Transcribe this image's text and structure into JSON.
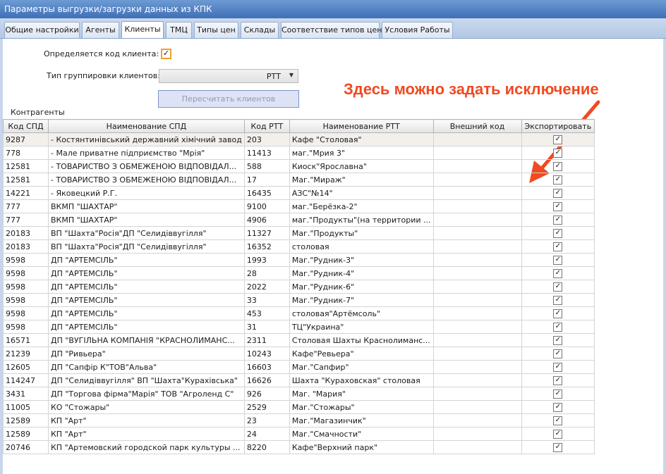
{
  "window": {
    "title": "Параметры выгрузки/загрузки данных из КПК"
  },
  "tabs": [
    {
      "label": "Общие настройки"
    },
    {
      "label": "Агенты"
    },
    {
      "label": "Клиенты"
    },
    {
      "label": "ТМЦ"
    },
    {
      "label": "Типы цен"
    },
    {
      "label": "Склады"
    },
    {
      "label": "Соответствие типов цен"
    },
    {
      "label": "Условия Работы"
    }
  ],
  "form": {
    "client_code_label": "Определяется код клиента:",
    "client_code_checked": true,
    "grouping_label": "Тип группировки клиентов:",
    "grouping_value": "РТТ",
    "recalc_button": "Пересчитать клиентов",
    "group_caption": "Контрагенты"
  },
  "annotation": {
    "text": "Здесь можно задать исключение",
    "color": "#f04a22"
  },
  "table": {
    "columns": [
      "Код СПД",
      "Наименование СПД",
      "Код РТТ",
      "Наименование РТТ",
      "Внешний код",
      "Экспортировать"
    ],
    "rows": [
      {
        "spd_code": "9287",
        "spd_name": "- Костянтинівський державний хімічний завод",
        "rtt_code": "203",
        "rtt_name": "Кафе \"Столовая\"",
        "ext": "",
        "export": true
      },
      {
        "spd_code": "778",
        "spd_name": "- Мале приватне підприємство \"Мрія\"",
        "rtt_code": "11413",
        "rtt_name": "маг.\"Мрия 3\"",
        "ext": "",
        "export": true
      },
      {
        "spd_code": "12581",
        "spd_name": "- ТОВАРИСТВО З ОБМЕЖЕНОЮ ВІДПОВІДАЛ...",
        "rtt_code": "588",
        "rtt_name": "Киоск\"Ярославна\"",
        "ext": "",
        "export": true
      },
      {
        "spd_code": "12581",
        "spd_name": "- ТОВАРИСТВО З ОБМЕЖЕНОЮ ВІДПОВІДАЛ...",
        "rtt_code": "17",
        "rtt_name": "Маг.\"Мираж\"",
        "ext": "",
        "export": true
      },
      {
        "spd_code": "14221",
        "spd_name": "- Яковецкий Р.Г.",
        "rtt_code": "16435",
        "rtt_name": "АЗС\"№14\"",
        "ext": "",
        "export": true
      },
      {
        "spd_code": "777",
        "spd_name": "ВКМП \"ШАХТАР\"",
        "rtt_code": "9100",
        "rtt_name": "маг.\"Берёзка-2\"",
        "ext": "",
        "export": true
      },
      {
        "spd_code": "777",
        "spd_name": "ВКМП \"ШАХТАР\"",
        "rtt_code": "4906",
        "rtt_name": "маг.\"Продукты\"(на территории ...",
        "ext": "",
        "export": true
      },
      {
        "spd_code": "20183",
        "spd_name": "ВП \"Шахта\"Росія\"ДП \"Селидіввугілля\"",
        "rtt_code": "11327",
        "rtt_name": "Маг.\"Продукты\"",
        "ext": "",
        "export": true
      },
      {
        "spd_code": "20183",
        "spd_name": "ВП \"Шахта\"Росія\"ДП \"Селидіввугілля\"",
        "rtt_code": "16352",
        "rtt_name": "столовая",
        "ext": "",
        "export": true
      },
      {
        "spd_code": "9598",
        "spd_name": "ДП \"АРТЕМСІЛЬ\"",
        "rtt_code": "1993",
        "rtt_name": "Маг.\"Рудник-3\"",
        "ext": "",
        "export": true
      },
      {
        "spd_code": "9598",
        "spd_name": "ДП \"АРТЕМСІЛЬ\"",
        "rtt_code": "28",
        "rtt_name": "Маг.\"Рудник-4\"",
        "ext": "",
        "export": true
      },
      {
        "spd_code": "9598",
        "spd_name": "ДП \"АРТЕМСІЛЬ\"",
        "rtt_code": "2022",
        "rtt_name": "Маг.\"Рудник-6\"",
        "ext": "",
        "export": true
      },
      {
        "spd_code": "9598",
        "spd_name": "ДП \"АРТЕМСІЛЬ\"",
        "rtt_code": "33",
        "rtt_name": "Маг.\"Рудник-7\"",
        "ext": "",
        "export": true
      },
      {
        "spd_code": "9598",
        "spd_name": "ДП \"АРТЕМСІЛЬ\"",
        "rtt_code": "453",
        "rtt_name": "столовая\"Артёмсоль\"",
        "ext": "",
        "export": true
      },
      {
        "spd_code": "9598",
        "spd_name": "ДП \"АРТЕМСІЛЬ\"",
        "rtt_code": "31",
        "rtt_name": "ТЦ\"Украина\"",
        "ext": "",
        "export": true
      },
      {
        "spd_code": "16571",
        "spd_name": "ДП \"ВУГІЛЬНА КОМПАНІЯ \"КРАСНОЛИМАНС...",
        "rtt_code": "2311",
        "rtt_name": "Столовая Шахты Краснолиманс...",
        "ext": "",
        "export": true
      },
      {
        "spd_code": "21239",
        "spd_name": "ДП \"Ривьера\"",
        "rtt_code": "10243",
        "rtt_name": "Кафе\"Ревьера\"",
        "ext": "",
        "export": true
      },
      {
        "spd_code": "12605",
        "spd_name": "ДП \"Сапфір К\"ТОВ\"Альва\"",
        "rtt_code": "16603",
        "rtt_name": "Маг.\"Сапфир\"",
        "ext": "",
        "export": true
      },
      {
        "spd_code": "114247",
        "spd_name": "ДП \"Селидіввугілля\" ВП \"Шахта\"Курахівська\"",
        "rtt_code": "16626",
        "rtt_name": "Шахта \"Кураховская\" столовая",
        "ext": "",
        "export": true
      },
      {
        "spd_code": "3431",
        "spd_name": "ДП \"Торгова фірма\"Марія\" ТОВ \"Агроленд С\"",
        "rtt_code": "926",
        "rtt_name": "Маг. \"Мария\"",
        "ext": "",
        "export": true
      },
      {
        "spd_code": "11005",
        "spd_name": "КО \"Стожары\"",
        "rtt_code": "2529",
        "rtt_name": "Маг.\"Стожары\"",
        "ext": "",
        "export": true
      },
      {
        "spd_code": "12589",
        "spd_name": "КП \"Арт\"",
        "rtt_code": "23",
        "rtt_name": "Маг.\"Магазинчик\"",
        "ext": "",
        "export": true
      },
      {
        "spd_code": "12589",
        "spd_name": "КП \"Арт\"",
        "rtt_code": "24",
        "rtt_name": "Маг.\"Смачности\"",
        "ext": "",
        "export": true
      },
      {
        "spd_code": "20746",
        "spd_name": "КП \"Артемовский городской парк культуры ...",
        "rtt_code": "8220",
        "rtt_name": "Кафе\"Верхний парк\"",
        "ext": "",
        "export": true
      }
    ]
  }
}
